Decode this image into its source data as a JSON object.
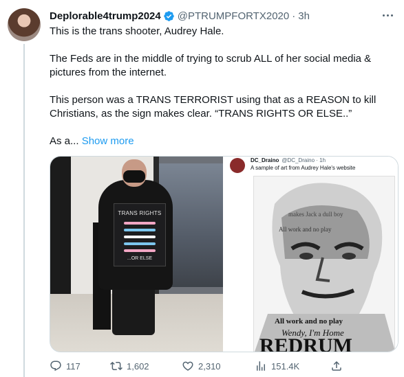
{
  "tweet": {
    "display_name": "Deplorable4trump2024",
    "handle": "@PTRUMPFORTX2020",
    "separator": "·",
    "time": "3h",
    "text_lines": [
      "This is the trans shooter, Audrey Hale.",
      "The Feds are in the middle of trying to scrub ALL of her social media & pictures from the internet.",
      "This person was a TRANS TERRORIST using that as a REASON to kill Christians, as the sign makes clear. “TRANS RIGHTS OR ELSE..”"
    ],
    "truncated_prefix": "As a...",
    "show_more": "Show more"
  },
  "media": {
    "left_sign_top": "TRANS RIGHTS",
    "left_sign_bottom": "...OR ELSE",
    "right_source_name": "DC_Draino",
    "right_source_handle": "@DC_Draino · 1h",
    "right_caption": "A sample of art from Audrey Hale's website",
    "art_word_top": "makes Jack a dull boy",
    "art_word_mid": "All work and no play",
    "art_word_lower": "Wendy, I'm Home",
    "art_word_bottom": "REDRUM"
  },
  "actions": {
    "replies": "117",
    "retweets": "1,602",
    "likes": "2,310",
    "views": "151.4K"
  },
  "colors": {
    "accent": "#1d9bf0",
    "text": "#0f1419",
    "muted": "#536471"
  }
}
